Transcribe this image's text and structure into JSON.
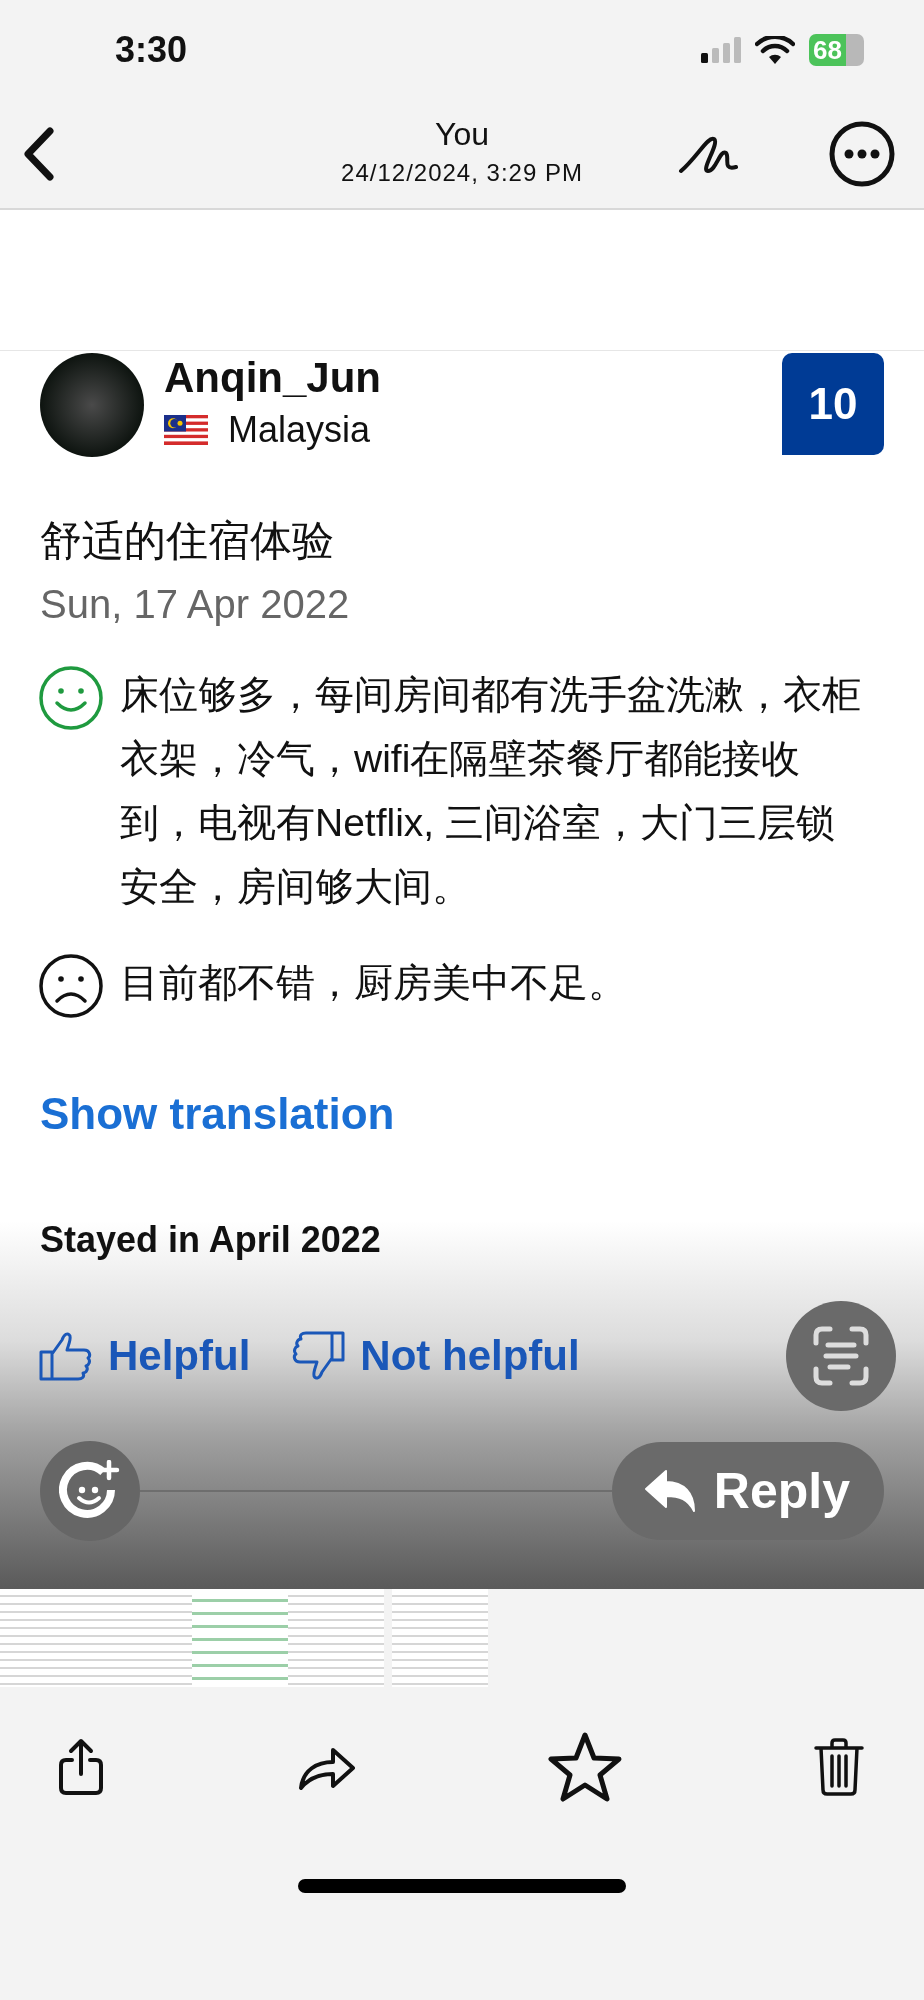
{
  "status_bar": {
    "time": "3:30",
    "battery": "68"
  },
  "nav": {
    "title": "You",
    "subtitle": "24/12/2024, 3:29 PM"
  },
  "review": {
    "reviewer": "Anqin_Jun",
    "country": "Malaysia",
    "score": "10",
    "title": "舒适的住宿体验",
    "date": "Sun, 17 Apr 2022",
    "comments": [
      {
        "kind": "positive",
        "text": "床位够多，每间房间都有洗手盆洗漱，衣柜衣架，冷气，wifi在隔壁茶餐厅都能接收到，电视有Netflix, 三间浴室，大门三层锁安全，房间够大间。"
      },
      {
        "kind": "negative",
        "text": "目前都不错，厨房美中不足。"
      }
    ],
    "translate_link": "Show translation",
    "stay": "Stayed in April 2022"
  },
  "feedback": [
    {
      "kind": "up",
      "label": "Helpful"
    },
    {
      "kind": "down",
      "label": "Not helpful"
    }
  ],
  "reply_button": "Reply"
}
